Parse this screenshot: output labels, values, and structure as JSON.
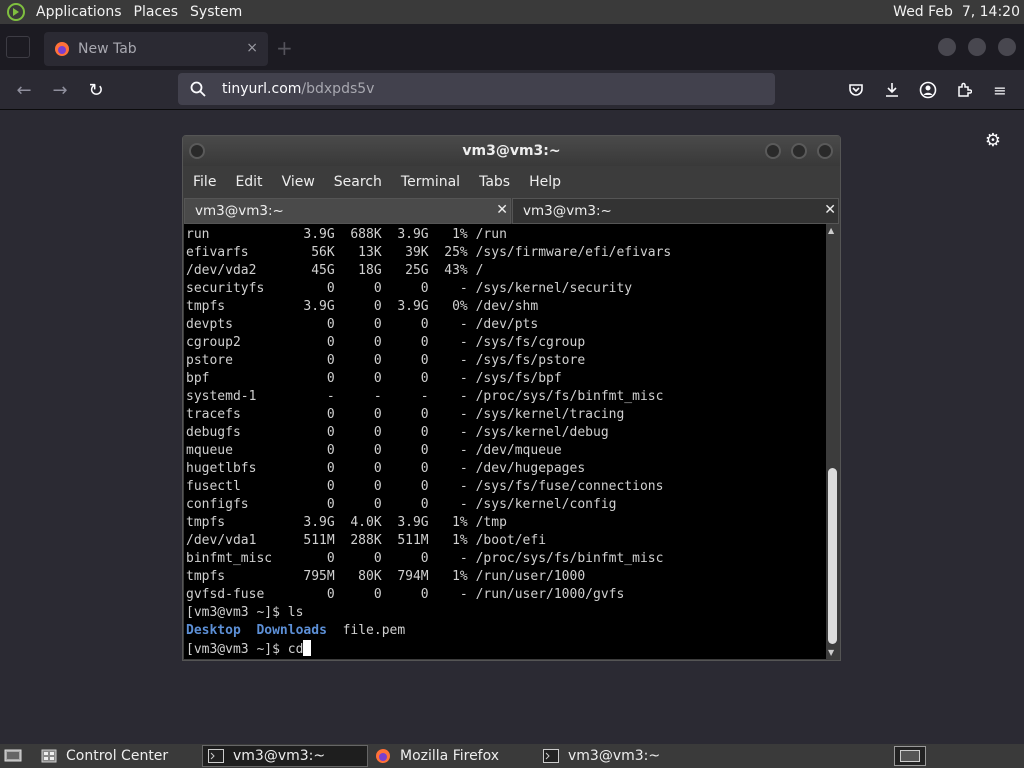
{
  "top_panel": {
    "menus": [
      "Applications",
      "Places",
      "System"
    ],
    "clock": "Wed Feb  7, 14:20"
  },
  "browser": {
    "tab_title": "New Tab",
    "tab_close": "×",
    "url_domain": "tinyurl.com",
    "url_path": "/bdxpds5v"
  },
  "terminal": {
    "window_title": "vm3@vm3:~",
    "menu": [
      "File",
      "Edit",
      "View",
      "Search",
      "Terminal",
      "Tabs",
      "Help"
    ],
    "tabs": [
      "vm3@vm3:~",
      "vm3@vm3:~"
    ],
    "lines": [
      "run            3.9G  688K  3.9G   1% /run",
      "efivarfs        56K   13K   39K  25% /sys/firmware/efi/efivars",
      "/dev/vda2       45G   18G   25G  43% /",
      "securityfs        0     0     0    - /sys/kernel/security",
      "tmpfs          3.9G     0  3.9G   0% /dev/shm",
      "devpts            0     0     0    - /dev/pts",
      "cgroup2           0     0     0    - /sys/fs/cgroup",
      "pstore            0     0     0    - /sys/fs/pstore",
      "bpf               0     0     0    - /sys/fs/bpf",
      "systemd-1         -     -     -    - /proc/sys/fs/binfmt_misc",
      "tracefs           0     0     0    - /sys/kernel/tracing",
      "debugfs           0     0     0    - /sys/kernel/debug",
      "mqueue            0     0     0    - /dev/mqueue",
      "hugetlbfs         0     0     0    - /dev/hugepages",
      "fusectl           0     0     0    - /sys/fs/fuse/connections",
      "configfs          0     0     0    - /sys/kernel/config",
      "tmpfs          3.9G  4.0K  3.9G   1% /tmp",
      "/dev/vda1      511M  288K  511M   1% /boot/efi",
      "binfmt_misc       0     0     0    - /proc/sys/fs/binfmt_misc",
      "tmpfs          795M   80K  794M   1% /run/user/1000",
      "gvfsd-fuse        0     0     0    - /run/user/1000/gvfs",
      "[vm3@vm3 ~]$ ls"
    ],
    "ls_output": {
      "dir1": "Desktop",
      "sep1": "  ",
      "dir2": "Downloads",
      "sep2": "  ",
      "file": "file.pem"
    },
    "prompt": "[vm3@vm3 ~]$ ",
    "current_input": "cd"
  },
  "taskbar": {
    "items": [
      "Control Center",
      "vm3@vm3:~",
      "Mozilla Firefox",
      "vm3@vm3:~"
    ]
  }
}
